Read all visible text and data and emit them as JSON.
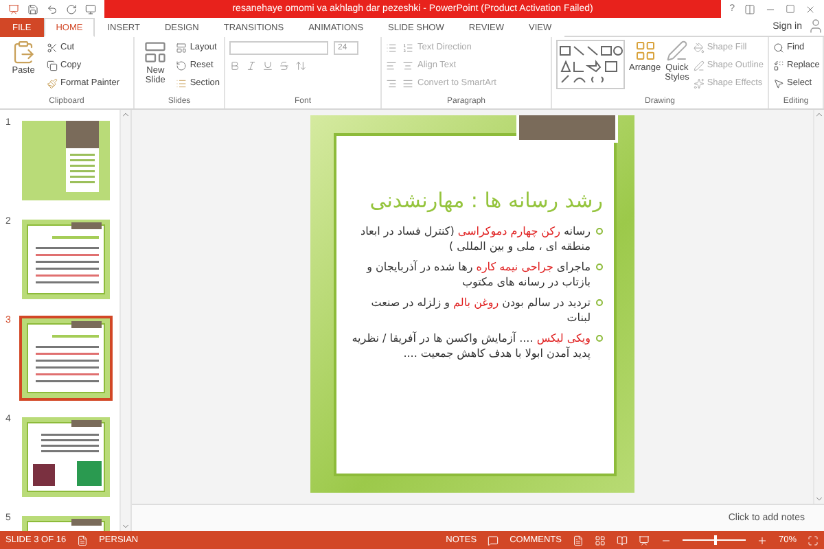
{
  "title_bar": {
    "title": "resanehaye omomi va akhlagh dar pezeshki - PowerPoint (Product Activation Failed)",
    "help": "?"
  },
  "tabs": [
    {
      "label": "FILE",
      "kind": "file",
      "selected": false
    },
    {
      "label": "HOME",
      "kind": "tab",
      "selected": true
    },
    {
      "label": "INSERT",
      "kind": "tab",
      "selected": false
    },
    {
      "label": "DESIGN",
      "kind": "tab",
      "selected": false
    },
    {
      "label": "TRANSITIONS",
      "kind": "tab",
      "selected": false
    },
    {
      "label": "ANIMATIONS",
      "kind": "tab",
      "selected": false
    },
    {
      "label": "SLIDE SHOW",
      "kind": "tab",
      "selected": false
    },
    {
      "label": "REVIEW",
      "kind": "tab",
      "selected": false
    },
    {
      "label": "VIEW",
      "kind": "tab",
      "selected": false
    }
  ],
  "sign_in": "Sign in",
  "clipboard": {
    "label": "Clipboard",
    "paste": "Paste",
    "cut": "Cut",
    "copy": "Copy",
    "format_painter": "Format Painter"
  },
  "slides_group": {
    "label": "Slides",
    "new_slide": "New Slide",
    "layout": "Layout",
    "reset": "Reset",
    "section": "Section"
  },
  "font": {
    "label": "Font",
    "size": "24"
  },
  "paragraph": {
    "label": "Paragraph",
    "text_direction": "Text Direction",
    "align_text": "Align Text",
    "convert": "Convert to SmartArt"
  },
  "drawing": {
    "label": "Drawing",
    "arrange": "Arrange",
    "quick_styles": "Quick Styles",
    "shape_fill": "Shape Fill",
    "shape_outline": "Shape Outline",
    "shape_effects": "Shape Effects"
  },
  "editing": {
    "label": "Editing",
    "find": "Find",
    "replace": "Replace",
    "select": "Select"
  },
  "thumbnails": [
    {
      "number": "1",
      "kind": "title",
      "selected": false
    },
    {
      "number": "2",
      "kind": "content",
      "selected": false
    },
    {
      "number": "3",
      "kind": "content",
      "selected": true
    },
    {
      "number": "4",
      "kind": "images",
      "selected": false
    },
    {
      "number": "5",
      "kind": "content",
      "selected": false
    }
  ],
  "slide": {
    "title": "رشد رسانه ها : مهارنشدنی",
    "bullets": [
      {
        "segments": [
          {
            "text": "رسانه ",
            "red": false
          },
          {
            "text": "رکن چهارم دموکراسی",
            "red": true
          },
          {
            "text": " (کنترل فساد در ابعاد منطقه ای ، ملی و بین المللی )",
            "red": false
          }
        ]
      },
      {
        "segments": [
          {
            "text": "ماجرای ",
            "red": false
          },
          {
            "text": "جراحی نیمه کاره",
            "red": true
          },
          {
            "text": " رها شده در آذربایجان و بازتاب در رسانه های مکتوب",
            "red": false
          }
        ]
      },
      {
        "segments": [
          {
            "text": "تردید در سالم بودن ",
            "red": false
          },
          {
            "text": "روغن بالم",
            "red": true
          },
          {
            "text": " و زلزله در صنعت لبنات",
            "red": false
          }
        ]
      },
      {
        "segments": [
          {
            "text": "ویکی لیکس",
            "red": true
          },
          {
            "text": " .... آزمایش واکسن ها در آفریقا / نظریه پدید آمدن ابولا با هدف کاهش جمعیت ....",
            "red": false
          }
        ]
      }
    ]
  },
  "notes": {
    "placeholder": "Click to add notes"
  },
  "status_bar": {
    "slide_indicator": "SLIDE 3 OF 16",
    "language": "PERSIAN",
    "notes": "NOTES",
    "comments": "COMMENTS",
    "zoom": "70%",
    "level": 0.5
  }
}
